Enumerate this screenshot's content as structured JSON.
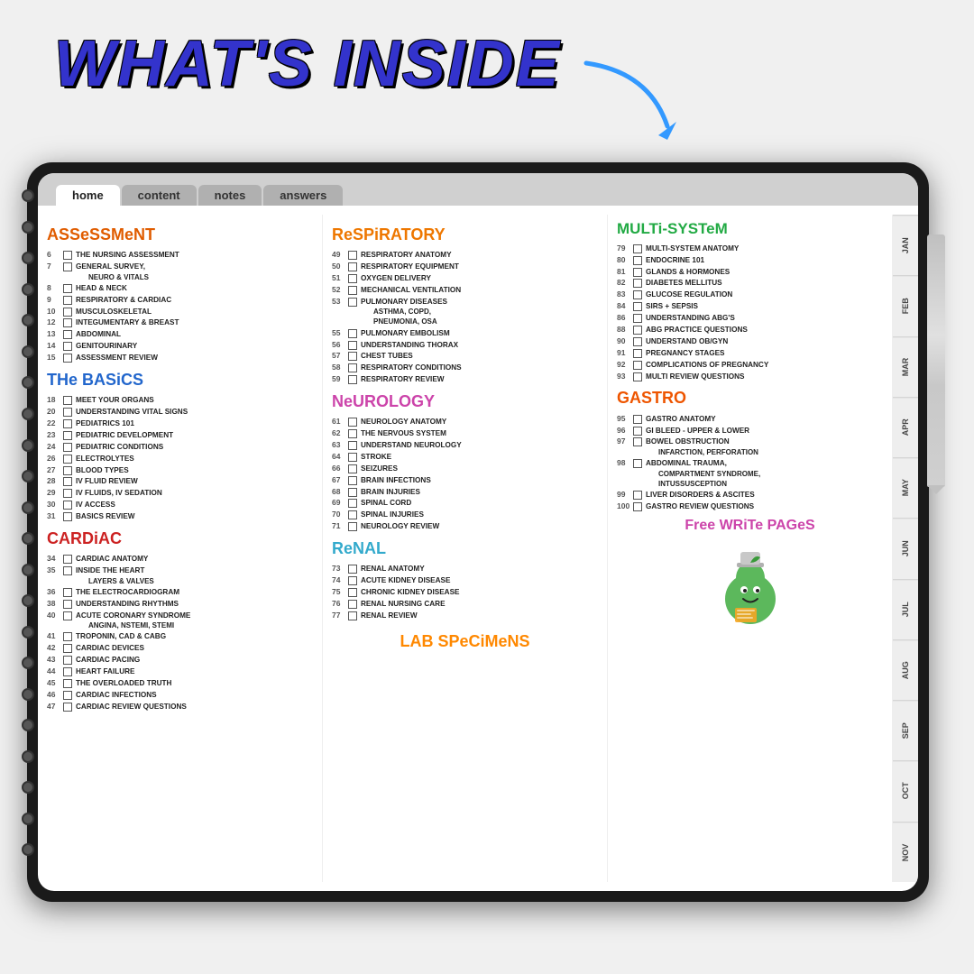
{
  "title": "WHAT'S INSIDE",
  "nav": {
    "tabs": [
      "HOMe",
      "CONTeNT",
      "NOTeS",
      "ANSWeRS"
    ],
    "active": 1
  },
  "months": [
    "JAN",
    "FEB",
    "MAR",
    "APR",
    "MAY",
    "JUN",
    "JUL",
    "AUG",
    "SEP",
    "OCT",
    "NOV"
  ],
  "col1": {
    "assessment": {
      "header": "ASSeSSMeNT",
      "items": [
        {
          "num": "6",
          "text": "THE NURSING ASSESSMENT"
        },
        {
          "num": "7",
          "text": "GENERAL SURVEY, NEURO & VITALS"
        },
        {
          "num": "8",
          "text": "HEAD & NECK"
        },
        {
          "num": "9",
          "text": "RESPIRATORY & CARDIAC"
        },
        {
          "num": "10",
          "text": "MUSCULOSKELETAL"
        },
        {
          "num": "12",
          "text": "INTEGUMENTARY & BREAST"
        },
        {
          "num": "13",
          "text": "ABDOMINAL"
        },
        {
          "num": "14",
          "text": "GENITOURINARY"
        },
        {
          "num": "15",
          "text": "ASSESSMENT REVIEW"
        }
      ]
    },
    "basics": {
      "header": "THe BASiCS",
      "items": [
        {
          "num": "18",
          "text": "MEET YOUR ORGANS"
        },
        {
          "num": "20",
          "text": "UNDERSTANDING VITAL SIGNS"
        },
        {
          "num": "22",
          "text": "PEDIATRICS 101"
        },
        {
          "num": "23",
          "text": "PEDIATRIC DEVELOPMENT"
        },
        {
          "num": "24",
          "text": "PEDIATRIC CONDITIONS"
        },
        {
          "num": "26",
          "text": "ELECTROLYTES"
        },
        {
          "num": "27",
          "text": "BLOOD TYPES"
        },
        {
          "num": "28",
          "text": "IV FLUID REVIEW"
        },
        {
          "num": "29",
          "text": "IV FLUIDS, IV SEDATION"
        },
        {
          "num": "30",
          "text": "IV ACCESS"
        },
        {
          "num": "31",
          "text": "BASICS REVIEW"
        }
      ]
    },
    "cardiac": {
      "header": "CARDiAC",
      "items": [
        {
          "num": "34",
          "text": "CARDIAC ANATOMY"
        },
        {
          "num": "35",
          "text": "INSIDE THE HEART LAYERS & VALVES"
        },
        {
          "num": "36",
          "text": "THE ELECTROCARDIOGRAM"
        },
        {
          "num": "38",
          "text": "UNDERSTANDING RHYTHMS"
        },
        {
          "num": "40",
          "text": "ACUTE CORONARY SYNDROME ANGINA, NSTEMI, STEMI"
        },
        {
          "num": "41",
          "text": "TROPONIN, CAD & CABG"
        },
        {
          "num": "42",
          "text": "CARDIAC DEVICES"
        },
        {
          "num": "43",
          "text": "CARDIAC PACING"
        },
        {
          "num": "44",
          "text": "HEART FAILURE"
        },
        {
          "num": "45",
          "text": "THE OVERLOADED TRUTH"
        },
        {
          "num": "46",
          "text": "CARDIAC INFECTIONS"
        },
        {
          "num": "47",
          "text": "CARDIAC REVIEW QUESTIONS"
        }
      ]
    }
  },
  "col2": {
    "respiratory": {
      "header": "ReSPiRATORY",
      "items": [
        {
          "num": "49",
          "text": "RESPIRATORY ANATOMY"
        },
        {
          "num": "50",
          "text": "RESPIRATORY EQUIPMENT"
        },
        {
          "num": "51",
          "text": "OXYGEN DELIVERY"
        },
        {
          "num": "52",
          "text": "MECHANICAL VENTILATION"
        },
        {
          "num": "53",
          "text": "PULMONARY DISEASES ASTHMA, COPD, PNEUMONIA, OSA"
        },
        {
          "num": "55",
          "text": "PULMONARY EMBOLISM"
        },
        {
          "num": "56",
          "text": "UNDERSTANDING THORAX"
        },
        {
          "num": "57",
          "text": "CHEST TUBES"
        },
        {
          "num": "58",
          "text": "RESPIRATORY CONDITIONS"
        },
        {
          "num": "59",
          "text": "RESPIRATORY REVIEW"
        }
      ]
    },
    "neurology": {
      "header": "NeUROLOGY",
      "items": [
        {
          "num": "61",
          "text": "NEUROLOGY ANATOMY"
        },
        {
          "num": "62",
          "text": "THE NERVOUS SYSTEM"
        },
        {
          "num": "63",
          "text": "UNDERSTAND NEUROLOGY"
        },
        {
          "num": "64",
          "text": "STROKE"
        },
        {
          "num": "66",
          "text": "SEIZURES"
        },
        {
          "num": "67",
          "text": "BRAIN INFECTIONS"
        },
        {
          "num": "68",
          "text": "BRAIN INJURIES"
        },
        {
          "num": "69",
          "text": "SPINAL CORD"
        },
        {
          "num": "70",
          "text": "SPINAL INJURIES"
        },
        {
          "num": "71",
          "text": "NEUROLOGY REVIEW"
        }
      ]
    },
    "renal": {
      "header": "ReNAL",
      "items": [
        {
          "num": "73",
          "text": "RENAL ANATOMY"
        },
        {
          "num": "74",
          "text": "ACUTE KIDNEY DISEASE"
        },
        {
          "num": "75",
          "text": "CHRONIC KIDNEY DISEASE"
        },
        {
          "num": "76",
          "text": "RENAL NURSING CARE"
        },
        {
          "num": "77",
          "text": "RENAL REVIEW"
        }
      ]
    },
    "lab": {
      "header": "LAB SPeCiMeNS"
    }
  },
  "col3": {
    "multisystem": {
      "header": "MULTi-SYSTeM",
      "items": [
        {
          "num": "79",
          "text": "MULTI-SYSTEM ANATOMY"
        },
        {
          "num": "80",
          "text": "ENDOCRINE 101"
        },
        {
          "num": "81",
          "text": "GLANDS & HORMONES"
        },
        {
          "num": "82",
          "text": "DIABETES MELLITUS"
        },
        {
          "num": "83",
          "text": "GLUCOSE REGULATION"
        },
        {
          "num": "84",
          "text": "SIRS + SEPSIS"
        },
        {
          "num": "86",
          "text": "UNDERSTANDING ABG'S"
        },
        {
          "num": "88",
          "text": "ABG PRACTICE QUESTIONS"
        },
        {
          "num": "90",
          "text": "UNDERSTAND OB/GYN"
        },
        {
          "num": "91",
          "text": "PREGNANCY STAGES"
        },
        {
          "num": "92",
          "text": "COMPLICATIONS OF PREGNANCY"
        },
        {
          "num": "93",
          "text": "MULTI REVIEW QUESTIONS"
        }
      ]
    },
    "gastro": {
      "header": "GASTRO",
      "items": [
        {
          "num": "95",
          "text": "GASTRO ANATOMY"
        },
        {
          "num": "96",
          "text": "GI BLEED - UPPER & LOWER"
        },
        {
          "num": "97",
          "text": "BOWEL OBSTRUCTION INFARCTION, PERFORATION"
        },
        {
          "num": "98",
          "text": "ABDOMINAL TRAUMA, COMPARTMENT SYNDROME, INTUSSUSCEPTION"
        },
        {
          "num": "99",
          "text": "LIVER DISORDERS & ASCITES"
        },
        {
          "num": "100",
          "text": "GASTRO REVIEW QUESTIONS"
        }
      ]
    },
    "freewrite": {
      "title": "Free WRiTe PAGeS"
    }
  }
}
